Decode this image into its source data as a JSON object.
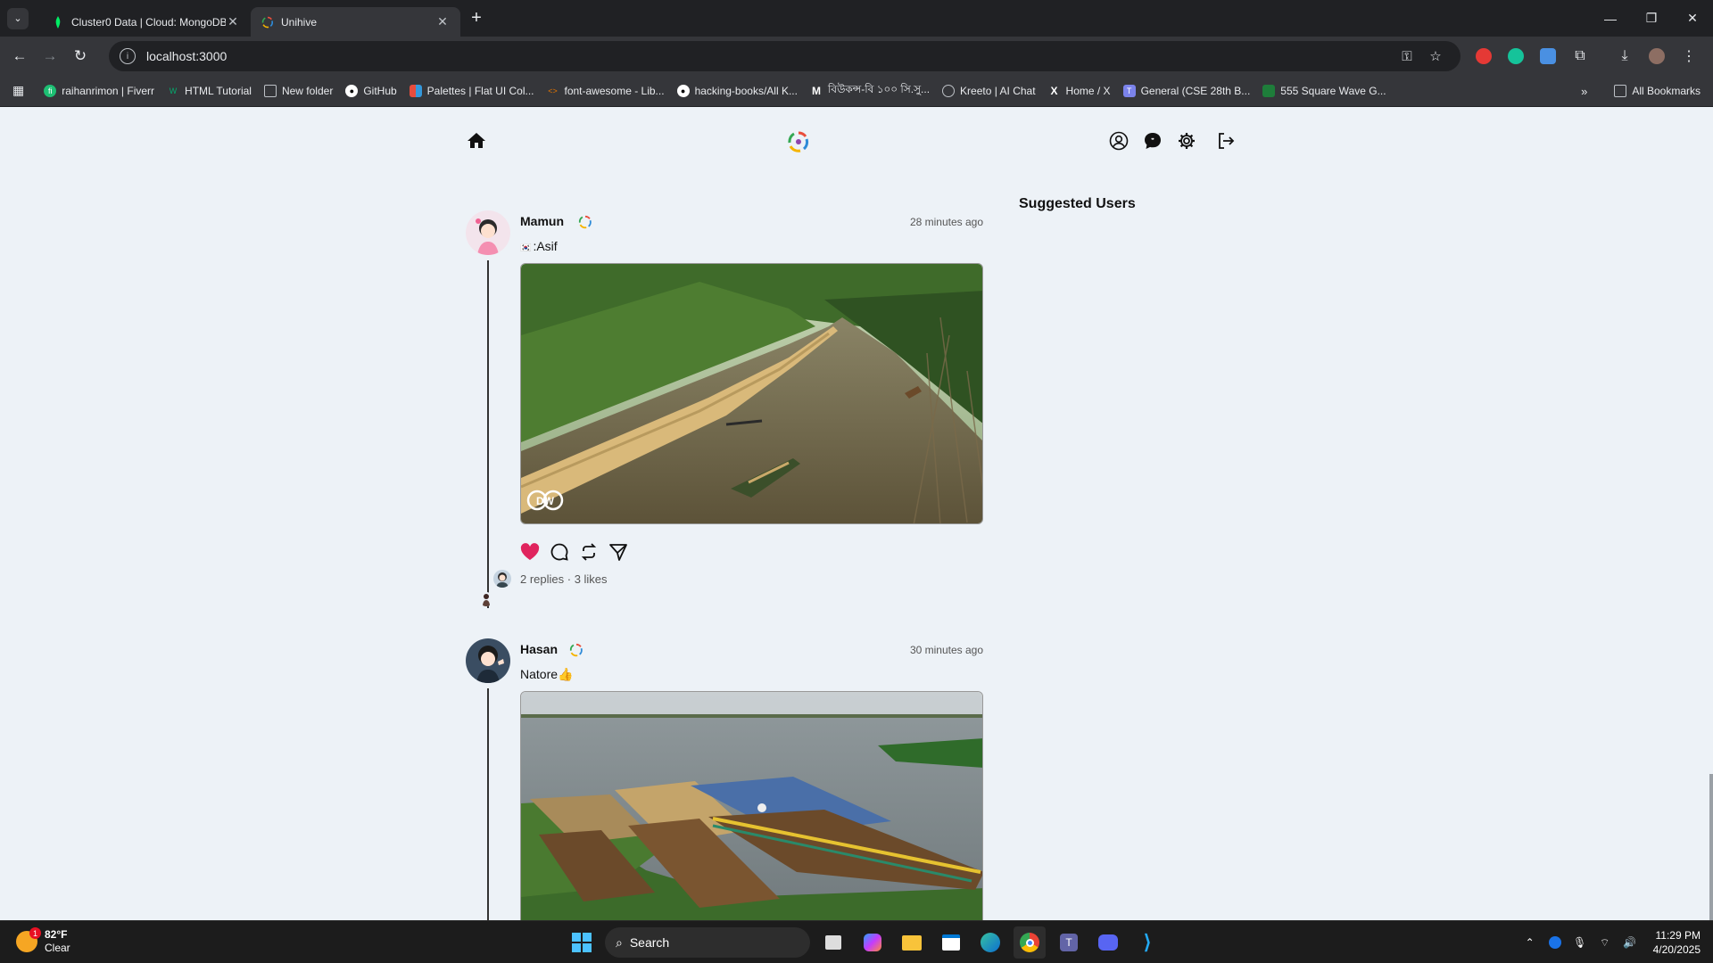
{
  "browser": {
    "tabs": [
      {
        "title": "Cluster0 Data | Cloud: MongoDB",
        "active": false
      },
      {
        "title": "Unihive",
        "active": true
      }
    ],
    "new_tab": "+",
    "url": "localhost:3000",
    "bookmarks": [
      {
        "label": "raihanrimon | Fiverr",
        "icon": "fiverr-icon",
        "color": "#1dbf73"
      },
      {
        "label": "HTML Tutorial",
        "icon": "w3schools-icon",
        "color": "#04aa6d"
      },
      {
        "label": "New folder",
        "icon": "folder-icon",
        "color": "#bdc1c6"
      },
      {
        "label": "GitHub",
        "icon": "github-icon",
        "color": "#ffffff"
      },
      {
        "label": "Palettes | Flat UI Col...",
        "icon": "palette-icon",
        "color": "#e74c3c"
      },
      {
        "label": "font-awesome - Lib...",
        "icon": "code-icon",
        "color": "#e37400"
      },
      {
        "label": "hacking-books/All K...",
        "icon": "github-icon",
        "color": "#ffffff"
      },
      {
        "label": "বিউকন্স-বি ১০০ সি.সু...",
        "icon": "m-icon",
        "color": "#ffffff"
      },
      {
        "label": "Kreeto | AI Chat",
        "icon": "kreeto-icon",
        "color": "#bdc1c6"
      },
      {
        "label": "Home / X",
        "icon": "x-icon",
        "color": "#ffffff"
      },
      {
        "label": "General (CSE 28th B...",
        "icon": "teams-icon",
        "color": "#7b83eb"
      },
      {
        "label": "555 Square Wave G...",
        "icon": "circuit-icon",
        "color": "#2ecc71"
      }
    ],
    "all_bookmarks": "All Bookmarks"
  },
  "app": {
    "suggested_title": "Suggested Users",
    "posts": [
      {
        "username": "Mamun",
        "time": "28 minutes ago",
        "caption": ":Asif",
        "stats": "2 replies · 3 likes",
        "liked": true,
        "watermark": "DW"
      },
      {
        "username": "Hasan",
        "time": "30 minutes ago",
        "caption": "Natore👍",
        "liked": false
      }
    ]
  },
  "taskbar": {
    "weather_temp": "82°F",
    "weather_desc": "Clear",
    "weather_badge": "1",
    "search_label": "Search",
    "time": "11:29 PM",
    "date": "4/20/2025"
  }
}
